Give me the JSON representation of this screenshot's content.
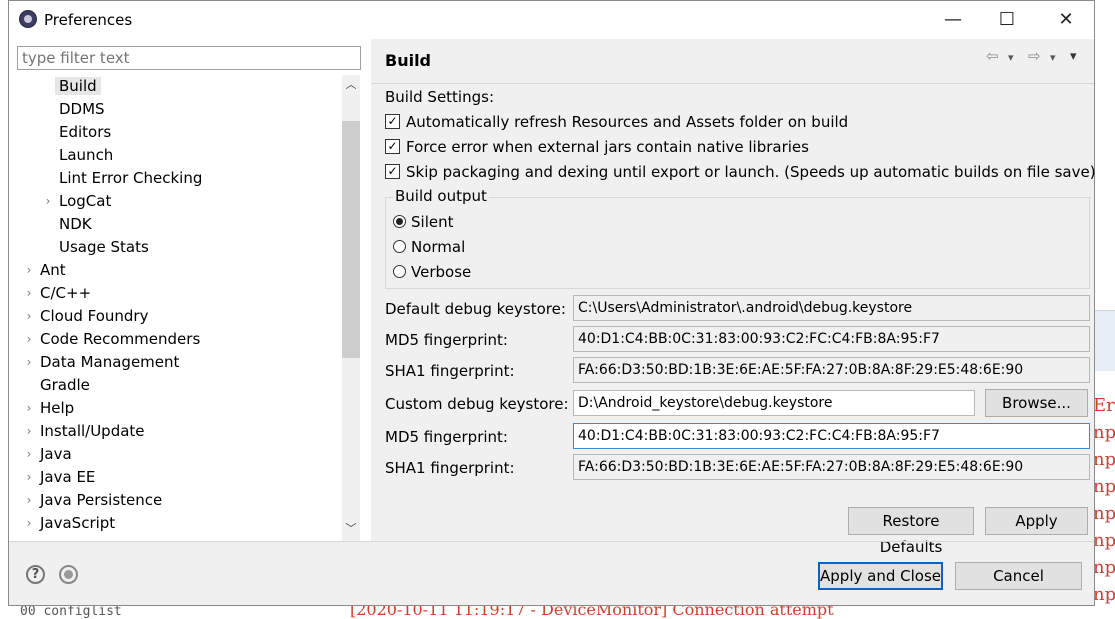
{
  "window": {
    "title": "Preferences",
    "minimize_glyph": "—",
    "maximize_glyph": "☐",
    "close_glyph": "✕"
  },
  "filter": {
    "placeholder": "type filter text",
    "value": ""
  },
  "tree": {
    "items": [
      {
        "label": "Build",
        "selected": true,
        "expandable": false
      },
      {
        "label": "DDMS",
        "expandable": false
      },
      {
        "label": "Editors",
        "expandable": false
      },
      {
        "label": "Launch",
        "expandable": false
      },
      {
        "label": "Lint Error Checking",
        "expandable": false
      },
      {
        "label": "LogCat",
        "expandable": true
      },
      {
        "label": "NDK",
        "expandable": false
      },
      {
        "label": "Usage Stats",
        "expandable": false
      },
      {
        "label": "Ant",
        "expandable": true
      },
      {
        "label": "C/C++",
        "expandable": true
      },
      {
        "label": "Cloud Foundry",
        "expandable": true
      },
      {
        "label": "Code Recommenders",
        "expandable": true
      },
      {
        "label": "Data Management",
        "expandable": true
      },
      {
        "label": "Gradle",
        "expandable": false
      },
      {
        "label": "Help",
        "expandable": true
      },
      {
        "label": "Install/Update",
        "expandable": true
      },
      {
        "label": "Java",
        "expandable": true
      },
      {
        "label": "Java EE",
        "expandable": true
      },
      {
        "label": "Java Persistence",
        "expandable": true
      },
      {
        "label": "JavaScript",
        "expandable": true
      }
    ]
  },
  "page": {
    "title": "Build",
    "nav_back": "⇦",
    "nav_forward": "⇨",
    "nav_menu": "▾",
    "build_settings_label": "Build Settings:",
    "checkboxes": [
      {
        "label": "Automatically refresh Resources and Assets folder on build",
        "checked": true
      },
      {
        "label": "Force error when external jars contain native libraries",
        "checked": true
      },
      {
        "label": "Skip packaging and dexing until export or launch. (Speeds up automatic builds on file save)",
        "checked": true
      }
    ],
    "build_output": {
      "legend": "Build output",
      "options": [
        {
          "label": "Silent",
          "selected": true
        },
        {
          "label": "Normal",
          "selected": false
        },
        {
          "label": "Verbose",
          "selected": false
        }
      ]
    },
    "fields": {
      "default_keystore_label": "Default debug keystore:",
      "default_keystore_value": "C:\\Users\\Administrator\\.android\\debug.keystore",
      "md5_label": "MD5 fingerprint:",
      "md5_value": "40:D1:C4:BB:0C:31:83:00:93:C2:FC:C4:FB:8A:95:F7",
      "sha1_label": "SHA1 fingerprint:",
      "sha1_value": "FA:66:D3:50:BD:1B:3E:6E:AE:5F:FA:27:0B:8A:8F:29:E5:48:6E:90",
      "custom_keystore_label": "Custom debug keystore:",
      "custom_keystore_value": "D:\\Android_keystore\\debug.keystore",
      "browse_label": "Browse...",
      "custom_md5_label": "MD5 fingerprint:",
      "custom_md5_value": "40:D1:C4:BB:0C:31:83:00:93:C2:FC:C4:FB:8A:95:F7",
      "custom_sha1_label": "SHA1 fingerprint:",
      "custom_sha1_value": "FA:66:D3:50:BD:1B:3E:6E:AE:5F:FA:27:0B:8A:8F:29:E5:48:6E:90"
    },
    "restore_defaults_label": "Restore Defaults",
    "apply_label": "Apply"
  },
  "footer": {
    "help_glyph": "?",
    "apply_close_label": "Apply and Close",
    "cancel_label": "Cancel"
  },
  "background": {
    "code_glyphs": "Er\nnp\nnp\nnp\nnp\nnp\nnp\nnp",
    "bottom_text": "00   configlist",
    "bottom_red": "[2020-10-11 11:19:17 - DeviceMonitor] Connection attempt"
  },
  "colors": {
    "accent_blue": "#0a64c8",
    "focus_border": "#3c88d9",
    "dialog_bg": "#f0f0f0",
    "selection_bg": "#e6e6e6"
  },
  "icons": {
    "app": "eclipse-icon",
    "help": "help-icon",
    "prefs": "preferences-link-icon"
  }
}
